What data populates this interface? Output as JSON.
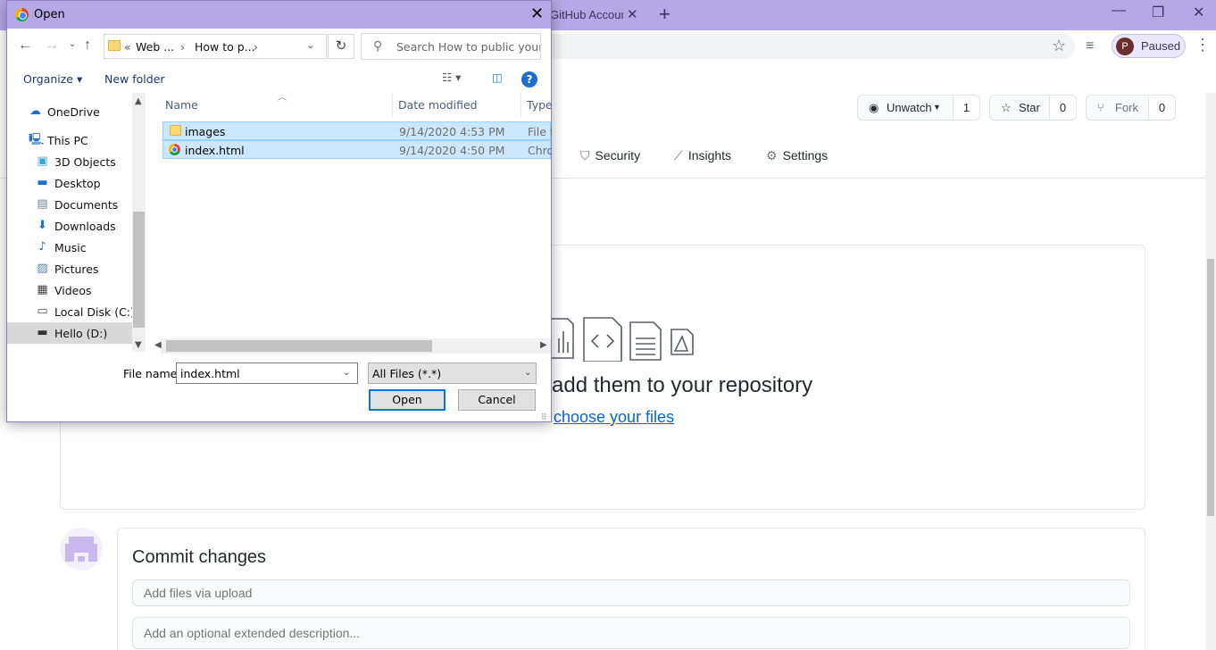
{
  "browser": {
    "tab_title": "GitHub Account",
    "tab_close": "✕",
    "new_tab": "+",
    "controls": {
      "minimize": "—",
      "restore": "❐",
      "close": "✕"
    },
    "profile_initial": "P",
    "profile_status": "Paused"
  },
  "github": {
    "unwatch": {
      "label": "Unwatch",
      "count": "1"
    },
    "star": {
      "label": "Star",
      "count": "0"
    },
    "fork": {
      "label": "Fork",
      "count": "0"
    },
    "nav": {
      "security": "Security",
      "insights": "Insights",
      "settings": "Settings"
    },
    "drop_text": "add them to your repository",
    "choose_link": "choose your files",
    "commit_title": "Commit changes",
    "commit_summary_placeholder": "Add files via upload",
    "commit_desc_placeholder": "Add an optional extended description..."
  },
  "dialog": {
    "title": "Open",
    "address": {
      "prefix": "«",
      "crumb1": "Web ...",
      "crumb2": "How to p...",
      "sep": "›"
    },
    "search_placeholder": "Search How to public your ...",
    "organize": "Organize ▾",
    "new_folder": "New folder",
    "help": "?",
    "nav_items": [
      {
        "label": "OneDrive",
        "icon": "cloud-icon"
      },
      {
        "label": "This PC",
        "icon": "computer-icon"
      },
      {
        "label": "3D Objects",
        "icon": "cube-icon"
      },
      {
        "label": "Desktop",
        "icon": "desktop-icon"
      },
      {
        "label": "Documents",
        "icon": "documents-icon"
      },
      {
        "label": "Downloads",
        "icon": "download-icon"
      },
      {
        "label": "Music",
        "icon": "music-icon"
      },
      {
        "label": "Pictures",
        "icon": "pictures-icon"
      },
      {
        "label": "Videos",
        "icon": "videos-icon"
      },
      {
        "label": "Local Disk (C:)",
        "icon": "disk-icon"
      },
      {
        "label": "Hello (D:)",
        "icon": "drive-icon"
      }
    ],
    "columns": {
      "name": "Name",
      "date": "Date modified",
      "type": "Type"
    },
    "files": [
      {
        "name": "images",
        "date": "9/14/2020 4:53 PM",
        "type": "File folder"
      },
      {
        "name": "index.html",
        "date": "9/14/2020 4:50 PM",
        "type": "Chrome HTML Document"
      }
    ],
    "file_name_label": "File name:",
    "file_name_value": "index.html",
    "filter": "All Files (*.*)",
    "open": "Open",
    "cancel": "Cancel"
  }
}
